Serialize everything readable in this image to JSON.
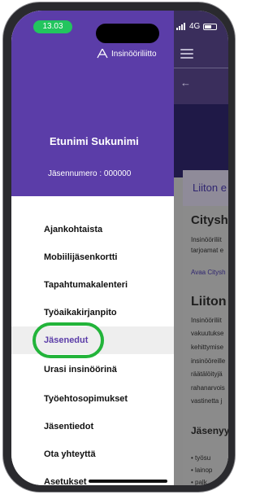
{
  "status_bar": {
    "time": "13.03",
    "network": "4G"
  },
  "drawer": {
    "logo_text": "Insinööriliitto",
    "user_name": "Etunimi Sukunimi",
    "member_number": "Jäsennumero : 000000",
    "items": [
      {
        "label": "Ajankohtaista"
      },
      {
        "label": "Mobiilijäsenkortti"
      },
      {
        "label": "Tapahtumakalenteri"
      },
      {
        "label": "Työaikakirjanpito"
      },
      {
        "label": "Jäsenedut"
      },
      {
        "label": "Urasi insinöörinä"
      },
      {
        "label": "Työehtosopimukset"
      },
      {
        "label": "Jäsentiedot"
      },
      {
        "label": "Ota yhteyttä"
      },
      {
        "label": "Asetukset"
      }
    ],
    "active_index": 4
  },
  "content": {
    "tab_label": "Liiton e",
    "section1_title": "Citysh",
    "section1_lines": [
      "Insinööriliit",
      "tarjoamat e"
    ],
    "section1_link": "Avaa Citysh",
    "section2_title": "Liiton",
    "section2_lines": [
      "Insinööriliit",
      "vakuutukse",
      "kehittymise",
      "insinööreille",
      "räätälöityjä",
      "rahanarvois",
      "vastinetta j"
    ],
    "section3_title": "Jäsenyy",
    "bullets": [
      "työsu",
      "lainop",
      "palk"
    ]
  },
  "colors": {
    "drawer_header": "#5b3da8",
    "active_text": "#5b3da8",
    "highlight_ring": "#22b43a",
    "status_pill": "#22c55e"
  }
}
